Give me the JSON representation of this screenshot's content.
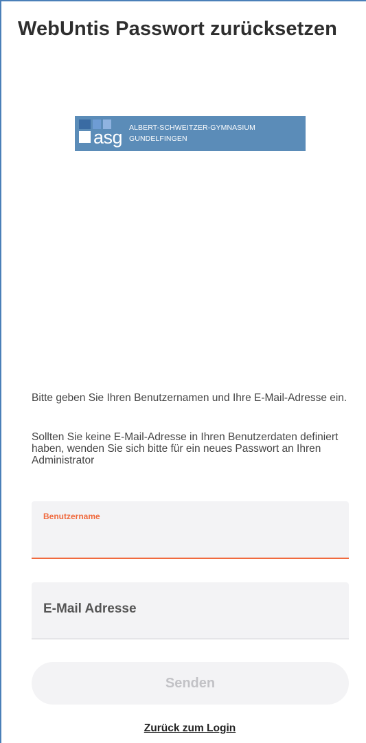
{
  "header": {
    "title": "WebUntis Passwort zurücksetzen"
  },
  "logo": {
    "abbr": "asg",
    "line1": "ALBERT-SCHWEITZER-GYMNASIUM",
    "line2": "GUNDELFINGEN",
    "background_color": "#5b8cb8"
  },
  "info": {
    "paragraph1": "Bitte geben Sie Ihren Benutzernamen und Ihre E-Mail-Adresse ein.",
    "paragraph2": "Sollten Sie keine E-Mail-Adresse in Ihren Benutzerdaten definiert haben, wenden Sie sich bitte für ein neues Passwort an Ihren Administrator"
  },
  "form": {
    "username": {
      "label": "Benutzername",
      "value": "",
      "focused": true
    },
    "email": {
      "placeholder": "E-Mail Adresse",
      "value": ""
    },
    "submit_label": "Senden",
    "submit_enabled": false
  },
  "links": {
    "back_to_login": "Zurück zum Login"
  },
  "colors": {
    "accent": "#f06a3e",
    "frame": "#4a7fb8",
    "field_background": "#f3f3f5"
  }
}
